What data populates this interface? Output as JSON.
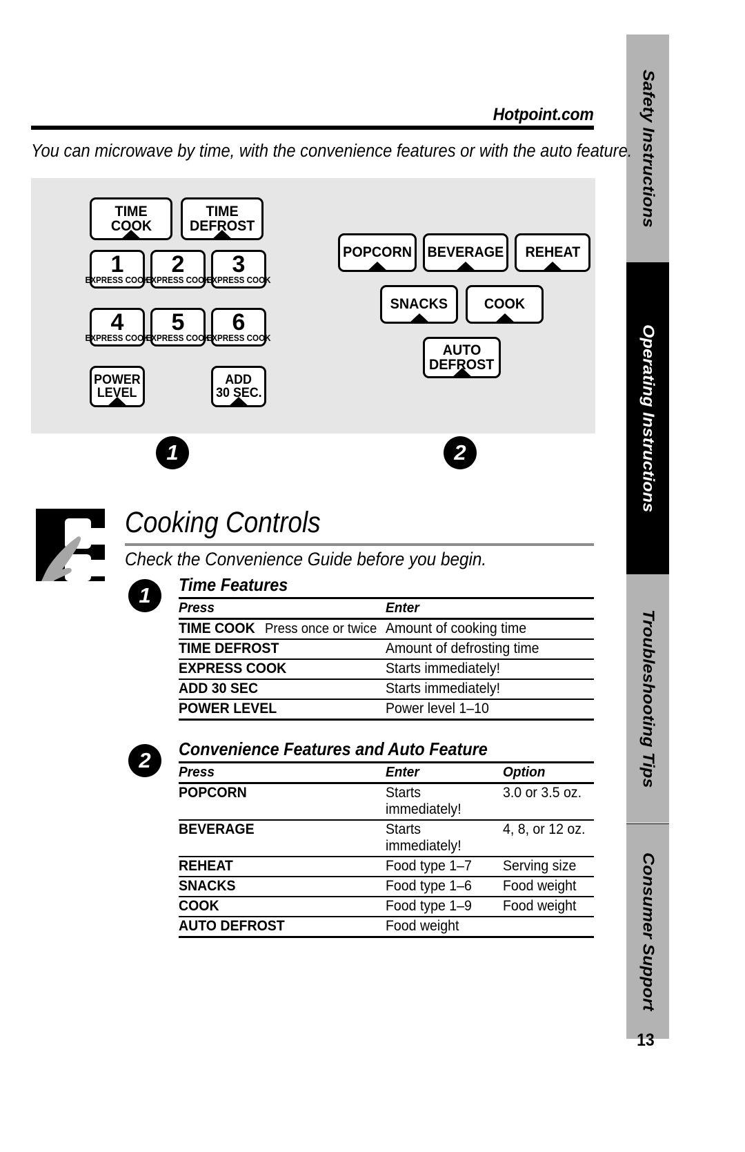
{
  "header": {
    "site": "Hotpoint.com",
    "intro": "You can microwave by time, with the convenience features or with the auto feature."
  },
  "sidebar": {
    "tabs": [
      {
        "label": "Safety Instructions",
        "active": false
      },
      {
        "label": "Operating Instructions",
        "active": true
      },
      {
        "label": "Troubleshooting Tips",
        "active": false
      },
      {
        "label": "Consumer Support",
        "active": false
      }
    ]
  },
  "control_panel": {
    "left_group": {
      "time_cook": {
        "line1": "TIME",
        "line2": "COOK"
      },
      "time_defrost": {
        "line1": "TIME",
        "line2": "DEFROST"
      },
      "express": [
        {
          "number": "1",
          "sublabel": "EXPRESS COOK"
        },
        {
          "number": "2",
          "sublabel": "EXPRESS COOK"
        },
        {
          "number": "3",
          "sublabel": "EXPRESS COOK"
        },
        {
          "number": "4",
          "sublabel": "EXPRESS COOK"
        },
        {
          "number": "5",
          "sublabel": "EXPRESS COOK"
        },
        {
          "number": "6",
          "sublabel": "EXPRESS COOK"
        }
      ],
      "power_level": {
        "line1": "POWER",
        "line2": "LEVEL"
      },
      "add_30_sec": {
        "line1": "ADD",
        "line2": "30 SEC."
      }
    },
    "right_group": {
      "popcorn": "POPCORN",
      "beverage": "BEVERAGE",
      "reheat": "REHEAT",
      "snacks": "SNACKS",
      "cook": "COOK",
      "auto_defrost": {
        "line1": "AUTO",
        "line2": "DEFROST"
      }
    },
    "callouts": {
      "one": "1",
      "two": "2"
    }
  },
  "section": {
    "title": "Cooking Controls",
    "subtitle": "Check the Convenience Guide before you begin.",
    "marker_one": "1",
    "marker_two": "2"
  },
  "table_time": {
    "title": "Time Features",
    "columns": [
      "Press",
      "Enter"
    ],
    "rows": [
      {
        "press": "TIME COOK",
        "note": "Press once or twice",
        "enter": "Amount of cooking time"
      },
      {
        "press": "TIME DEFROST",
        "note": "",
        "enter": "Amount of defrosting time"
      },
      {
        "press": "EXPRESS COOK",
        "note": "",
        "enter": "Starts immediately!"
      },
      {
        "press": "ADD 30 SEC",
        "note": "",
        "enter": "Starts immediately!"
      },
      {
        "press": "POWER LEVEL",
        "note": "",
        "enter": "Power level 1–10"
      }
    ]
  },
  "table_convenience": {
    "title": "Convenience Features and Auto Feature",
    "columns": [
      "Press",
      "Enter",
      "Option"
    ],
    "rows": [
      {
        "press": "POPCORN",
        "enter": "Starts immediately!",
        "option": "3.0 or 3.5 oz."
      },
      {
        "press": "BEVERAGE",
        "enter": "Starts immediately!",
        "option": "4, 8, or 12 oz."
      },
      {
        "press": "REHEAT",
        "enter": "Food type 1–7",
        "option": "Serving size"
      },
      {
        "press": "SNACKS",
        "enter": "Food type 1–6",
        "option": "Food weight"
      },
      {
        "press": "COOK",
        "enter": "Food type 1–9",
        "option": "Food weight"
      },
      {
        "press": "AUTO DEFROST",
        "enter": "Food weight",
        "option": ""
      }
    ]
  },
  "footer": {
    "page_number": "13"
  },
  "colors": {
    "panel_bg": "#e6e6e6",
    "tab_inactive": "#b3b3b3",
    "tab_active": "#000000",
    "rule": "#000000",
    "section_rule": "#8c8c8c",
    "hand_gray": "#a6a6a6"
  }
}
